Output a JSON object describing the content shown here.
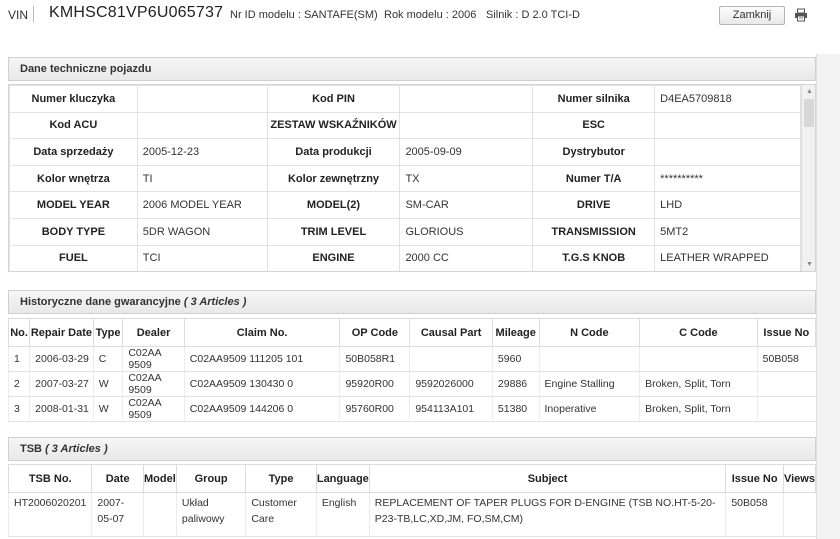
{
  "header": {
    "vin_label": "VIN",
    "vin_value": "KMHSC81VP6U065737",
    "model_id": "Nr ID modelu : SANTAFE(SM)",
    "model_year": "Rok modelu : 2006",
    "engine": "Silnik : D 2.0 TCI-D",
    "close_label": "Zamknij"
  },
  "tech": {
    "title": "Dane techniczne pojazdu",
    "rows": [
      {
        "l1": "Numer kluczyka",
        "v1": "",
        "l2": "Kod PIN",
        "v2": "",
        "l3": "Numer silnika",
        "v3": "D4EA5709818"
      },
      {
        "l1": "Kod ACU",
        "v1": "",
        "l2": "ZESTAW WSKAŹNIKÓW",
        "v2": "",
        "l3": "ESC",
        "v3": ""
      },
      {
        "l1": "Data sprzedaży",
        "v1": "2005-12-23",
        "l2": "Data produkcji",
        "v2": "2005-09-09",
        "l3": "Dystrybutor",
        "v3": ""
      },
      {
        "l1": "Kolor wnętrza",
        "v1": "TI",
        "l2": "Kolor zewnętrzny",
        "v2": "TX",
        "l3": "Numer T/A",
        "v3": "**********"
      },
      {
        "l1": "MODEL YEAR",
        "v1": "2006 MODEL YEAR",
        "l2": "MODEL(2)",
        "v2": "SM-CAR",
        "l3": "DRIVE",
        "v3": "LHD"
      },
      {
        "l1": "BODY TYPE",
        "v1": "5DR WAGON",
        "l2": "TRIM LEVEL",
        "v2": "GLORIOUS",
        "l3": "TRANSMISSION",
        "v3": "5MT2"
      },
      {
        "l1": "FUEL",
        "v1": "TCI",
        "l2": "ENGINE",
        "v2": "2000 CC",
        "l3": "T.G.S KNOB",
        "v3": "LEATHER WRAPPED"
      }
    ]
  },
  "warranty": {
    "title": "Historyczne dane gwarancyjne",
    "count": "( 3 Articles )",
    "columns": [
      "No.",
      "Repair Date",
      "Type",
      "Dealer",
      "Claim No.",
      "OP Code",
      "Causal Part",
      "Mileage",
      "N Code",
      "C Code",
      "Issue No"
    ],
    "rows": [
      [
        "1",
        "2006-03-29",
        "C",
        "C02AA 9509",
        "C02AA9509 111205 101",
        "50B058R1",
        "",
        "5960",
        "",
        "",
        "50B058"
      ],
      [
        "2",
        "2007-03-27",
        "W",
        "C02AA 9509",
        "C02AA9509 130430 0",
        "95920R00",
        "9592026000",
        "29886",
        "Engine Stalling",
        "Broken, Split, Torn",
        ""
      ],
      [
        "3",
        "2008-01-31",
        "W",
        "C02AA 9509",
        "C02AA9509 144206 0",
        "95760R00",
        "954113A101",
        "51380",
        "Inoperative",
        "Broken, Split, Torn",
        ""
      ]
    ]
  },
  "tsb": {
    "title": "TSB",
    "count": "( 3 Articles )",
    "columns": [
      "TSB No.",
      "Date",
      "Model",
      "Group",
      "Type",
      "Language",
      "Subject",
      "Issue No",
      "Views"
    ],
    "rows": [
      [
        "HT2006020201",
        "2007-05-07",
        "",
        "Układ paliwowy",
        "Customer Care",
        "English",
        "REPLACEMENT OF TAPER PLUGS FOR D-ENGINE (TSB NO.HT-5-20-P23-TB,LC,XD,JM, FO,SM,CM)",
        "50B058",
        ""
      ]
    ]
  }
}
